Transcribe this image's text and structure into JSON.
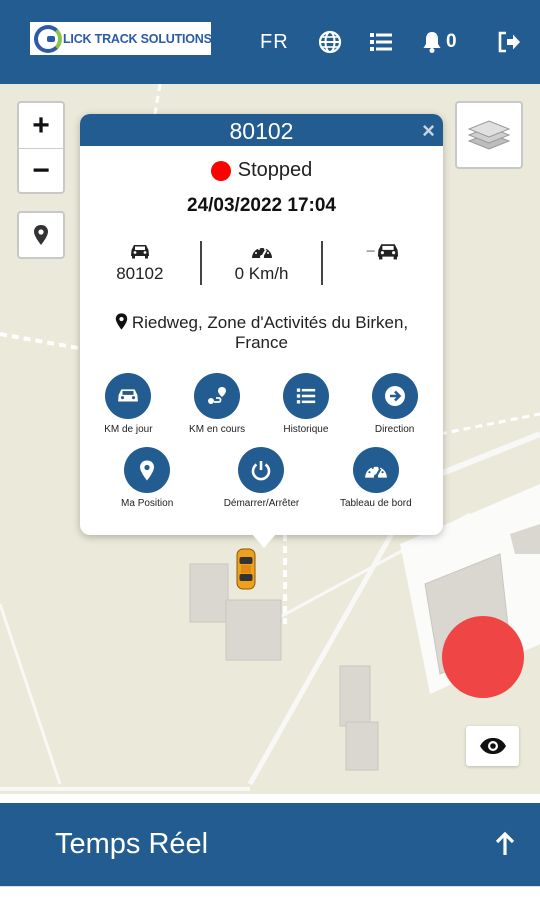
{
  "header": {
    "logo_text": "LICK TRACK SOLUTIONS",
    "language": "FR",
    "notification_count": "0"
  },
  "map": {
    "zoom_in": "+",
    "zoom_out": "−"
  },
  "popup": {
    "vehicle_id": "80102",
    "close": "×",
    "status": "Stopped",
    "datetime": "24/03/2022 17:04",
    "stats": {
      "vehicle": "80102",
      "speed": "0 Km/h",
      "driver": "---"
    },
    "address": "Riedweg, Zone d'Activités du Birken, France",
    "actions": [
      {
        "label": "KM de jour",
        "icon": "car-icon"
      },
      {
        "label": "KM en cours",
        "icon": "route-icon"
      },
      {
        "label": "Historique",
        "icon": "list-icon"
      },
      {
        "label": "Direction",
        "icon": "arrow-right-icon"
      },
      {
        "label": "Ma Position",
        "icon": "map-pin-icon"
      },
      {
        "label": "Démarrer/Arrêter",
        "icon": "power-icon"
      },
      {
        "label": "Tableau de bord",
        "icon": "gauge-icon"
      }
    ]
  },
  "bottom": {
    "title": "Temps Réel"
  },
  "colors": {
    "primary": "#235c90",
    "status_stopped": "#ff0000",
    "fab": "#f04545",
    "map_bg": "#ebe9d9"
  }
}
